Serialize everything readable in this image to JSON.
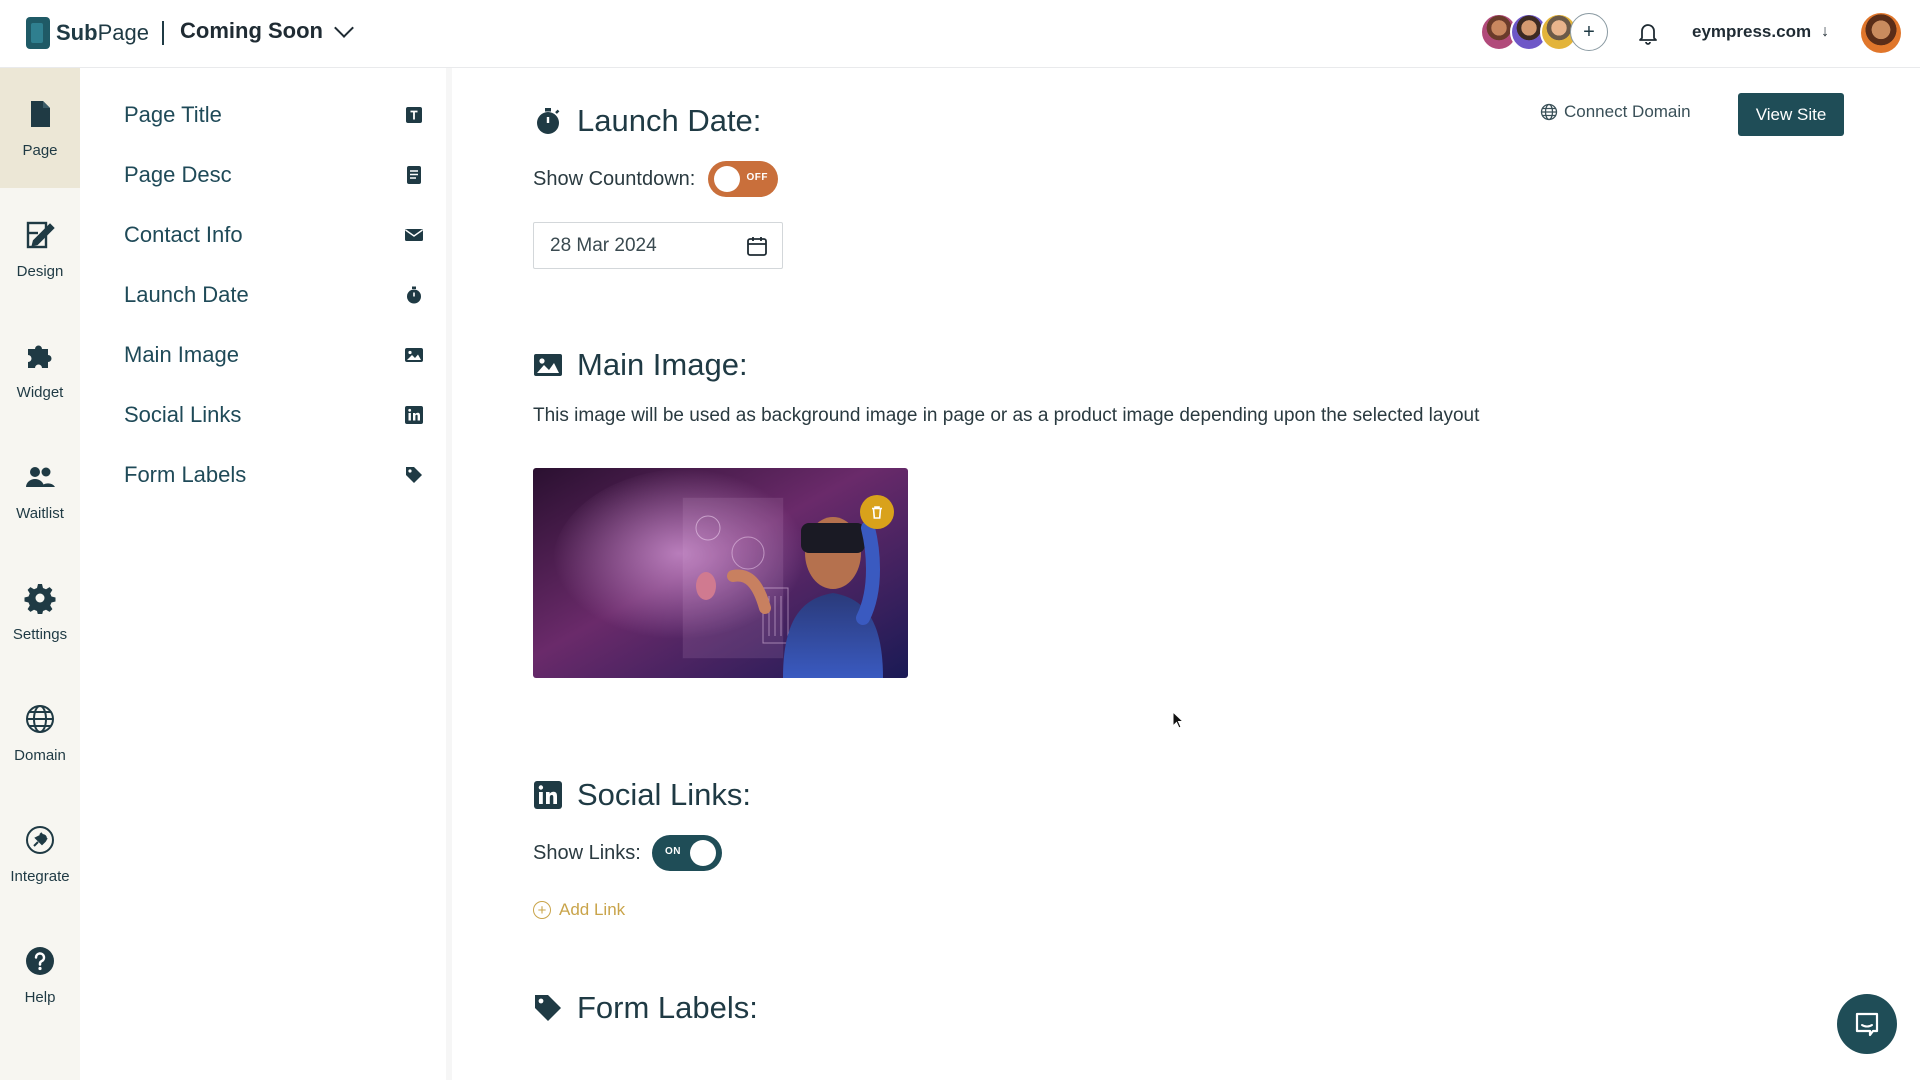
{
  "brand": {
    "name_bold": "Sub",
    "name_rest": "Page"
  },
  "page_selector": {
    "label": "Coming Soon"
  },
  "header": {
    "account": "eympress.com",
    "account_arrow": "↓",
    "add_member": "+"
  },
  "rail": [
    {
      "label": "Page",
      "icon": "page-icon",
      "active": true
    },
    {
      "label": "Design",
      "icon": "design-icon"
    },
    {
      "label": "Widget",
      "icon": "puzzle-icon"
    },
    {
      "label": "Waitlist",
      "icon": "users-icon"
    },
    {
      "label": "Settings",
      "icon": "gear-icon"
    },
    {
      "label": "Domain",
      "icon": "globe-icon"
    },
    {
      "label": "Integrate",
      "icon": "plug-icon"
    },
    {
      "label": "Help",
      "icon": "help-icon"
    }
  ],
  "nav": [
    {
      "label": "Page Title",
      "icon": "text-icon"
    },
    {
      "label": "Page Desc",
      "icon": "document-icon"
    },
    {
      "label": "Contact Info",
      "icon": "envelope-icon"
    },
    {
      "label": "Launch Date",
      "icon": "stopwatch-icon"
    },
    {
      "label": "Main Image",
      "icon": "image-icon"
    },
    {
      "label": "Social Links",
      "icon": "linkedin-icon"
    },
    {
      "label": "Form Labels",
      "icon": "tag-icon"
    }
  ],
  "actions": {
    "connect_domain": "Connect Domain",
    "view_site": "View Site"
  },
  "launch_date": {
    "title": "Launch Date:",
    "countdown_label": "Show Countdown:",
    "countdown_state": "OFF",
    "date_value": "28 Mar 2024"
  },
  "main_image": {
    "title": "Main Image:",
    "description": "This image will be used as background image in page or as a product image depending upon the selected layout"
  },
  "social_links": {
    "title": "Social Links:",
    "show_label": "Show Links:",
    "show_state": "ON",
    "add_link": "Add Link",
    "add_icon_glyph": "+"
  },
  "form_labels": {
    "title": "Form Labels:"
  },
  "colors": {
    "primary": "#1f4d57",
    "toggle_off": "#c96f3b",
    "accent": "#c9a44a",
    "rail_bg": "#f7f6f1",
    "rail_active": "#ece7d6"
  }
}
